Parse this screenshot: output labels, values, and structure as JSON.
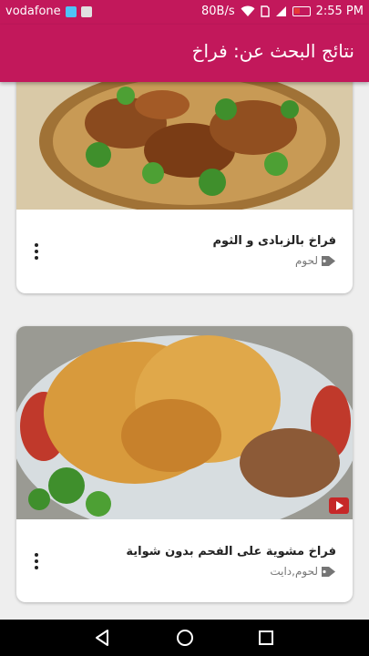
{
  "status_bar": {
    "carrier": "vodafone",
    "speed": "80B/s",
    "time": "2:55 PM"
  },
  "app_bar": {
    "title": "نتائج البحث عن: فراخ"
  },
  "recipes": [
    {
      "title": "فراخ بالزبادى و الثوم",
      "tags": "لحوم",
      "has_video": false
    },
    {
      "title": "فراخ مشوية على الفحم بدون شواية",
      "tags": "لحوم,دايت",
      "has_video": true
    }
  ],
  "icons": {
    "tag": "tag-icon",
    "more": "more-vert-icon",
    "wifi": "wifi-icon",
    "signal": "signal-icon",
    "battery": "battery-icon",
    "play": "play-icon",
    "back": "back-icon",
    "home": "home-icon",
    "recent": "recent-apps-icon"
  },
  "colors": {
    "primary": "#c2185b",
    "battery_low": "#e53935",
    "video_badge": "#c62828"
  }
}
